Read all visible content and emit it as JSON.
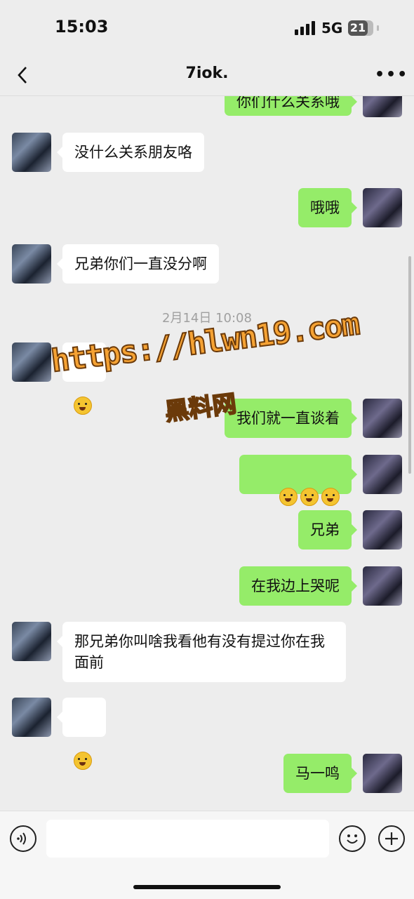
{
  "status": {
    "time": "15:03",
    "network": "5G",
    "battery": "21"
  },
  "header": {
    "title": "7iok.",
    "back_icon": "chevron-left-icon",
    "more_label": "•••"
  },
  "messages": [
    {
      "side": "right",
      "text": "你们什么关系哦"
    },
    {
      "side": "left",
      "text": "没什么关系朋友咯"
    },
    {
      "side": "right",
      "text": "哦哦"
    },
    {
      "side": "left",
      "text": "兄弟你们一直没分啊"
    },
    {
      "side": "left",
      "text": "",
      "emoji": "flushed-face"
    },
    {
      "side": "right",
      "text": "我们就一直谈着"
    },
    {
      "side": "right",
      "text": "",
      "emoji": "zipper-mouth-face x3"
    },
    {
      "side": "right",
      "text": "兄弟"
    },
    {
      "side": "right",
      "text": "在我边上哭呢"
    },
    {
      "side": "left",
      "text": "那兄弟你叫啥我看他有没有提过你在我面前"
    },
    {
      "side": "left",
      "text": "",
      "emoji": "grinning-face"
    },
    {
      "side": "right",
      "text": "马一鸣"
    }
  ],
  "timestamp": "2月14日 10:08",
  "watermark": {
    "url": "https://hlwn19.com",
    "cn": "黑料网"
  },
  "input": {
    "voice_icon": "voice-icon",
    "emoji_icon": "emoji-icon",
    "plus_icon": "plus-icon"
  }
}
